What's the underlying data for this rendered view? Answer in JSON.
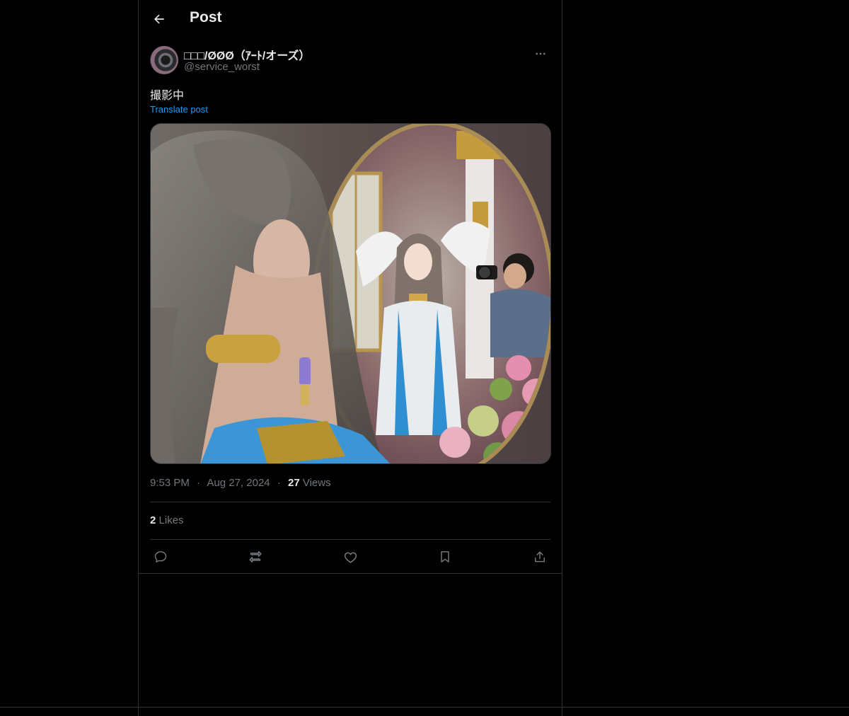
{
  "header": {
    "title": "Post"
  },
  "author": {
    "display_name": "□□□/ØØØ（ｱｰﾄ/オーズ）",
    "handle": "@service_worst"
  },
  "post": {
    "text": "撮影中",
    "translate_label": "Translate post",
    "time": "9:53 PM",
    "date": "Aug 27, 2024",
    "separator": "·",
    "views_count": "27",
    "views_label": "Views",
    "likes_count": "2",
    "likes_label": "Likes"
  },
  "icons": {
    "back": "arrow-left-icon",
    "more": "more-horizontal-icon",
    "reply": "reply-icon",
    "repost": "repost-icon",
    "like": "heart-icon",
    "bookmark": "bookmark-icon",
    "share": "share-icon"
  },
  "colors": {
    "background": "#000000",
    "border": "#2f3336",
    "text_primary": "#e7e9ea",
    "text_secondary": "#71767b",
    "link": "#1d9bf0"
  }
}
